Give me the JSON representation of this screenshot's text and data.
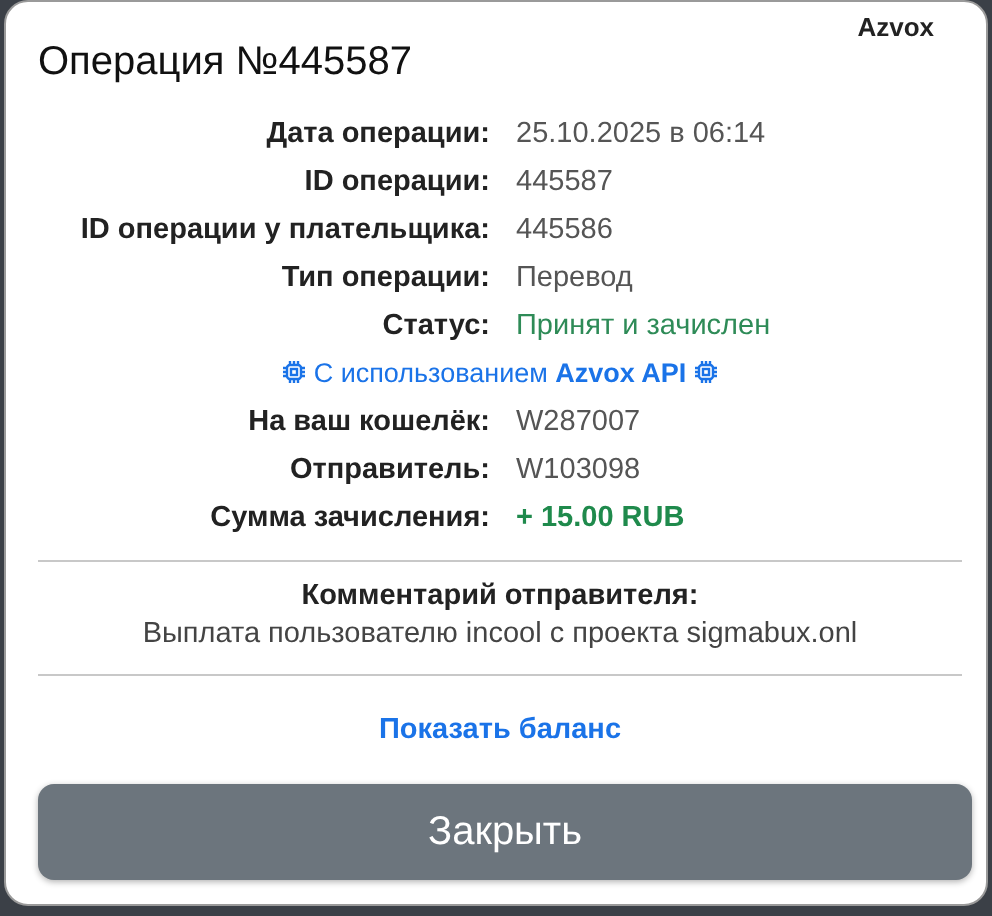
{
  "brand": "Azvox",
  "title": "Операция №445587",
  "details": [
    {
      "kind": "field",
      "label": "Дата операции:",
      "value": "25.10.2025 в 06:14"
    },
    {
      "kind": "field",
      "label": "ID операции:",
      "value": "445587"
    },
    {
      "kind": "field",
      "label": "ID операции у плательщика:",
      "value": "445586"
    },
    {
      "kind": "field",
      "label": "Тип операции:",
      "value": "Перевод"
    },
    {
      "kind": "status",
      "label": "Статус:",
      "value": "Принят и зачислен"
    },
    {
      "kind": "note",
      "text": "С использованием **Azvox API**"
    },
    {
      "kind": "field",
      "label": "На ваш кошелёк:",
      "value": "W287007"
    },
    {
      "kind": "field",
      "label": "Отправитель:",
      "value": "W103098"
    },
    {
      "kind": "amount",
      "label": "Сумма зачисления:",
      "value": "+ 15.00 RUB"
    }
  ],
  "comment": {
    "heading": "Комментарий отправителя:",
    "text": "Выплата пользователю incool с проекта sigmabux.onl"
  },
  "balance_link": "Показать баланс",
  "close_button": "Закрыть"
}
